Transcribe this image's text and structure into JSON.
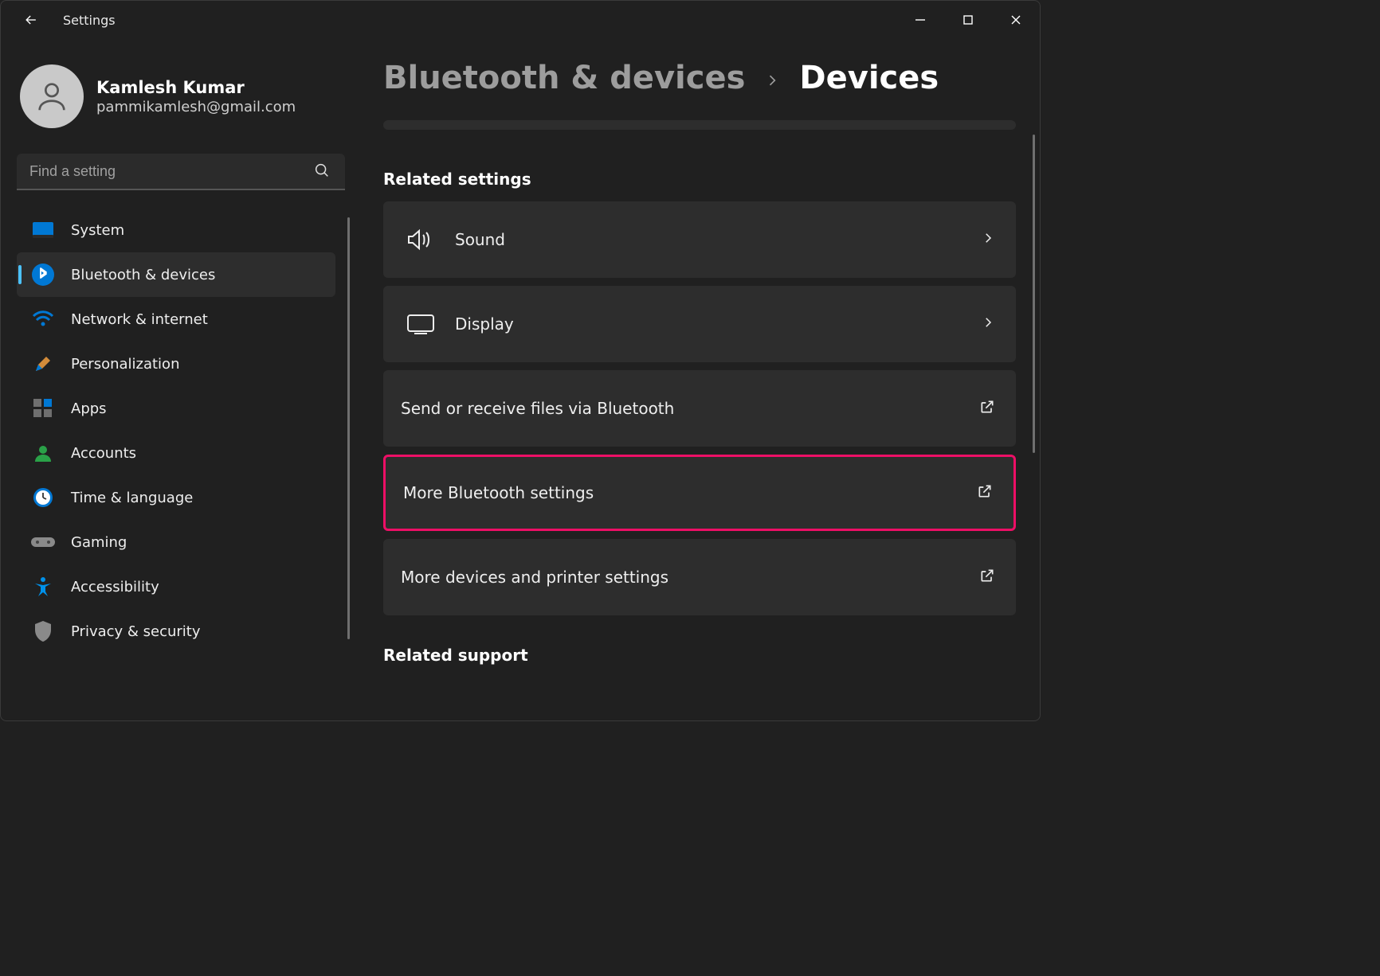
{
  "app": {
    "title": "Settings"
  },
  "profile": {
    "name": "Kamlesh Kumar",
    "email": "pammikamlesh@gmail.com"
  },
  "search": {
    "placeholder": "Find a setting"
  },
  "sidebar": {
    "items": [
      {
        "label": "System"
      },
      {
        "label": "Bluetooth & devices",
        "active": true
      },
      {
        "label": "Network & internet"
      },
      {
        "label": "Personalization"
      },
      {
        "label": "Apps"
      },
      {
        "label": "Accounts"
      },
      {
        "label": "Time & language"
      },
      {
        "label": "Gaming"
      },
      {
        "label": "Accessibility"
      },
      {
        "label": "Privacy & security"
      }
    ]
  },
  "breadcrumb": {
    "parent": "Bluetooth & devices",
    "current": "Devices"
  },
  "relatedSettings": {
    "title": "Related settings",
    "items": [
      {
        "label": "Sound"
      },
      {
        "label": "Display"
      },
      {
        "label": "Send or receive files via Bluetooth"
      },
      {
        "label": "More Bluetooth settings",
        "highlight": true
      },
      {
        "label": "More devices and printer settings"
      }
    ]
  },
  "relatedSupport": {
    "title": "Related support"
  }
}
